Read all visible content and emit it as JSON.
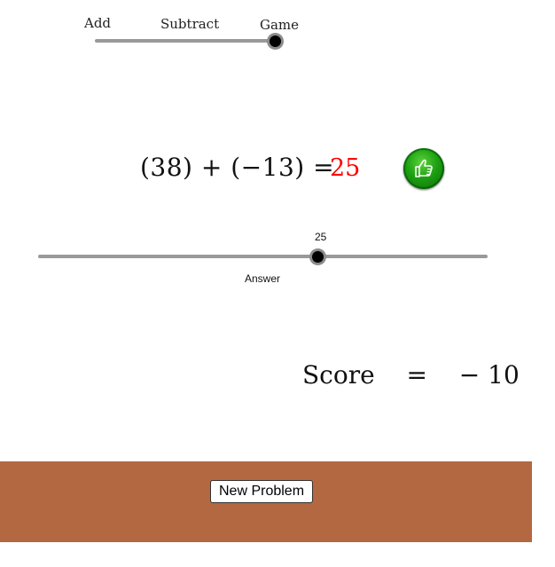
{
  "mode_slider": {
    "labels": [
      "Add",
      "Subtract",
      "Game"
    ],
    "selected": "Game"
  },
  "problem": {
    "equation": "(38) + (−13) =",
    "answer": "25",
    "answer_color": "#ff0000"
  },
  "answer_slider": {
    "value_label": "25",
    "label": "Answer"
  },
  "score": {
    "label": "Score",
    "equals": "=",
    "value": "− 10"
  },
  "controls": {
    "new_problem_label": "New Problem"
  },
  "colors": {
    "bottom_bar": "#b36841",
    "check_button": "#1da012",
    "slider_track": "#999999"
  },
  "icons": {
    "check_button": "thumbs-up-icon"
  }
}
